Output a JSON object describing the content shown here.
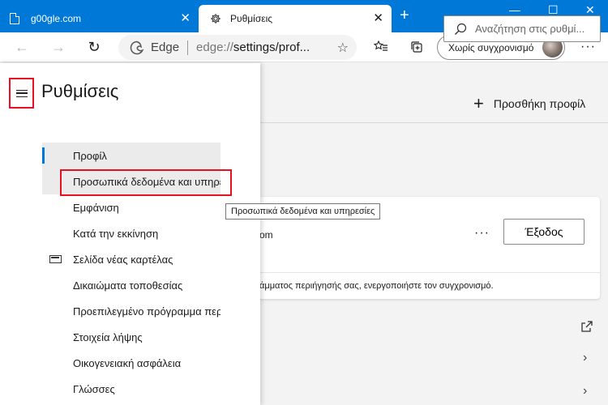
{
  "tabs": [
    {
      "title": "g00gle.com",
      "close": "✕"
    },
    {
      "title": "Ρυθμίσεις",
      "close": "✕"
    }
  ],
  "window_controls": {
    "minimize": "—",
    "maximize": "☐",
    "close": "✕"
  },
  "new_tab": "+",
  "toolbar": {
    "back": "←",
    "forward": "→",
    "refresh": "↻",
    "address_brand": "Edge",
    "address_scheme": "edge://",
    "address_path": "settings/prof...",
    "star": "☆",
    "sync_label": "Χωρίς συγχρονισμό",
    "more": "···"
  },
  "sidebar": {
    "title": "Ρυθμίσεις",
    "items": [
      {
        "label": "Προφίλ"
      },
      {
        "label": "Προσωπικά δεδομένα και υπηρεσίες"
      },
      {
        "label": "Εμφάνιση"
      },
      {
        "label": "Κατά την εκκίνηση"
      },
      {
        "label": "Σελίδα νέας καρτέλας"
      },
      {
        "label": "Δικαιώματα τοποθεσίας"
      },
      {
        "label": "Προεπιλεγμένο πρόγραμμα περιήγησης"
      },
      {
        "label": "Στοιχεία λήψης"
      },
      {
        "label": "Οικογενειακή ασφάλεια"
      },
      {
        "label": "Γλώσσες"
      }
    ],
    "tooltip": "Προσωπικά δεδομένα και υπηρεσίες"
  },
  "main": {
    "search_placeholder": "Αναζήτηση στις ρυθμί...",
    "add_profile": "Προσθήκη προφίλ",
    "card_email_fragment": "om",
    "card_more": "···",
    "signout": "Έξοδος",
    "sync_message": "άμματος περιήγησής σας, ενεργοποιήστε τον συγχρονισμό."
  },
  "colors": {
    "accent": "#0078d7",
    "highlight_red": "#e81123"
  }
}
